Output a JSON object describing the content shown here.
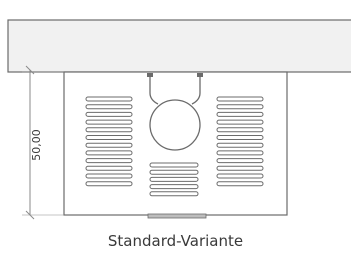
{
  "dimension": {
    "value": "50,00"
  },
  "caption": "Standard-Variante",
  "colors": {
    "line": "#6b6b6b",
    "thin_line": "#8a8a8a",
    "fill": "#f1f1f1",
    "slot_fill": "#ffffff",
    "text": "#3a3a3a"
  }
}
